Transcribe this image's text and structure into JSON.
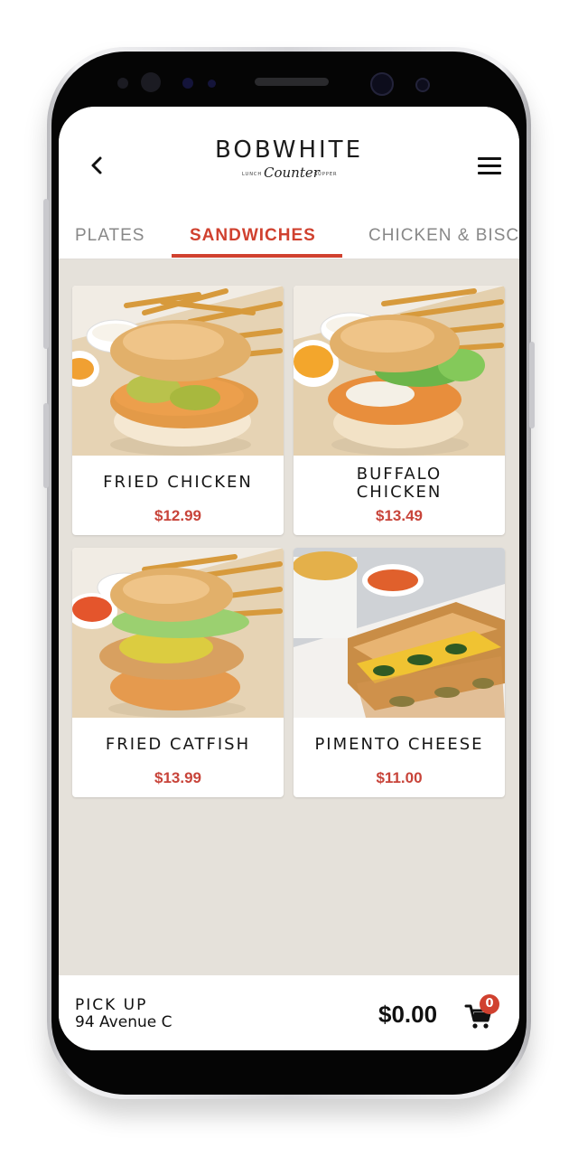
{
  "header": {
    "brand": "BOBWHITE",
    "brand_script": "Counter",
    "brand_left": "LUNCH",
    "brand_right": "SUPPER",
    "back_icon": "chevron-left-icon",
    "menu_icon": "hamburger-menu-icon"
  },
  "tabs": [
    {
      "label": "PLATES",
      "active": false
    },
    {
      "label": "SANDWICHES",
      "active": true
    },
    {
      "label": "CHICKEN & BISC",
      "active": false
    }
  ],
  "menu_items": [
    {
      "title": "FRIED CHICKEN",
      "price": "$12.99"
    },
    {
      "title_line1": "BUFFALO",
      "title_line2": "CHICKEN",
      "price": "$13.49"
    },
    {
      "title": "FRIED CATFISH",
      "price": "$13.99"
    },
    {
      "title": "PIMENTO CHEESE",
      "price": "$11.00"
    }
  ],
  "footer": {
    "pickup_label": "PICK UP",
    "address": "94 Avenue C",
    "total": "$0.00",
    "cart_count": "0",
    "cart_icon": "cart-icon"
  },
  "colors": {
    "accent": "#d0412f",
    "price": "#c8443a",
    "background": "#e5e1da"
  }
}
